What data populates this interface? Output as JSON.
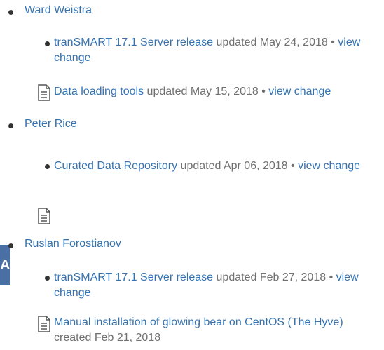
{
  "users": [
    {
      "name": "Ward Weistra",
      "items": [
        {
          "title": "tranSMART 17.1 Server release",
          "meta": "updated May 24, 2018",
          "action": "view change",
          "sep": "•"
        },
        {
          "title": "Data loading tools",
          "meta": "updated May 15, 2018",
          "action": "view change",
          "sep": "•"
        }
      ]
    },
    {
      "name": "Peter Rice",
      "items": [
        {
          "title": "Curated Data Repository",
          "meta": "updated Apr 06, 2018",
          "action": "view change",
          "sep": "•"
        }
      ]
    },
    {
      "name": "Ruslan Forostianov",
      "items": [
        {
          "title": "tranSMART 17.1 Server release",
          "meta": "updated Feb 27, 2018",
          "action": "view change",
          "sep": "•"
        },
        {
          "title": "Manual installation of glowing bear on CentOS (The Hyve)",
          "meta": "created Feb 21, 2018"
        }
      ]
    }
  ],
  "side_block_letter": "A",
  "icons": {
    "page": "document-page-icon"
  },
  "colors": {
    "link": "#3572b0",
    "muted": "#707070",
    "side_block": "#4a6fa5"
  }
}
